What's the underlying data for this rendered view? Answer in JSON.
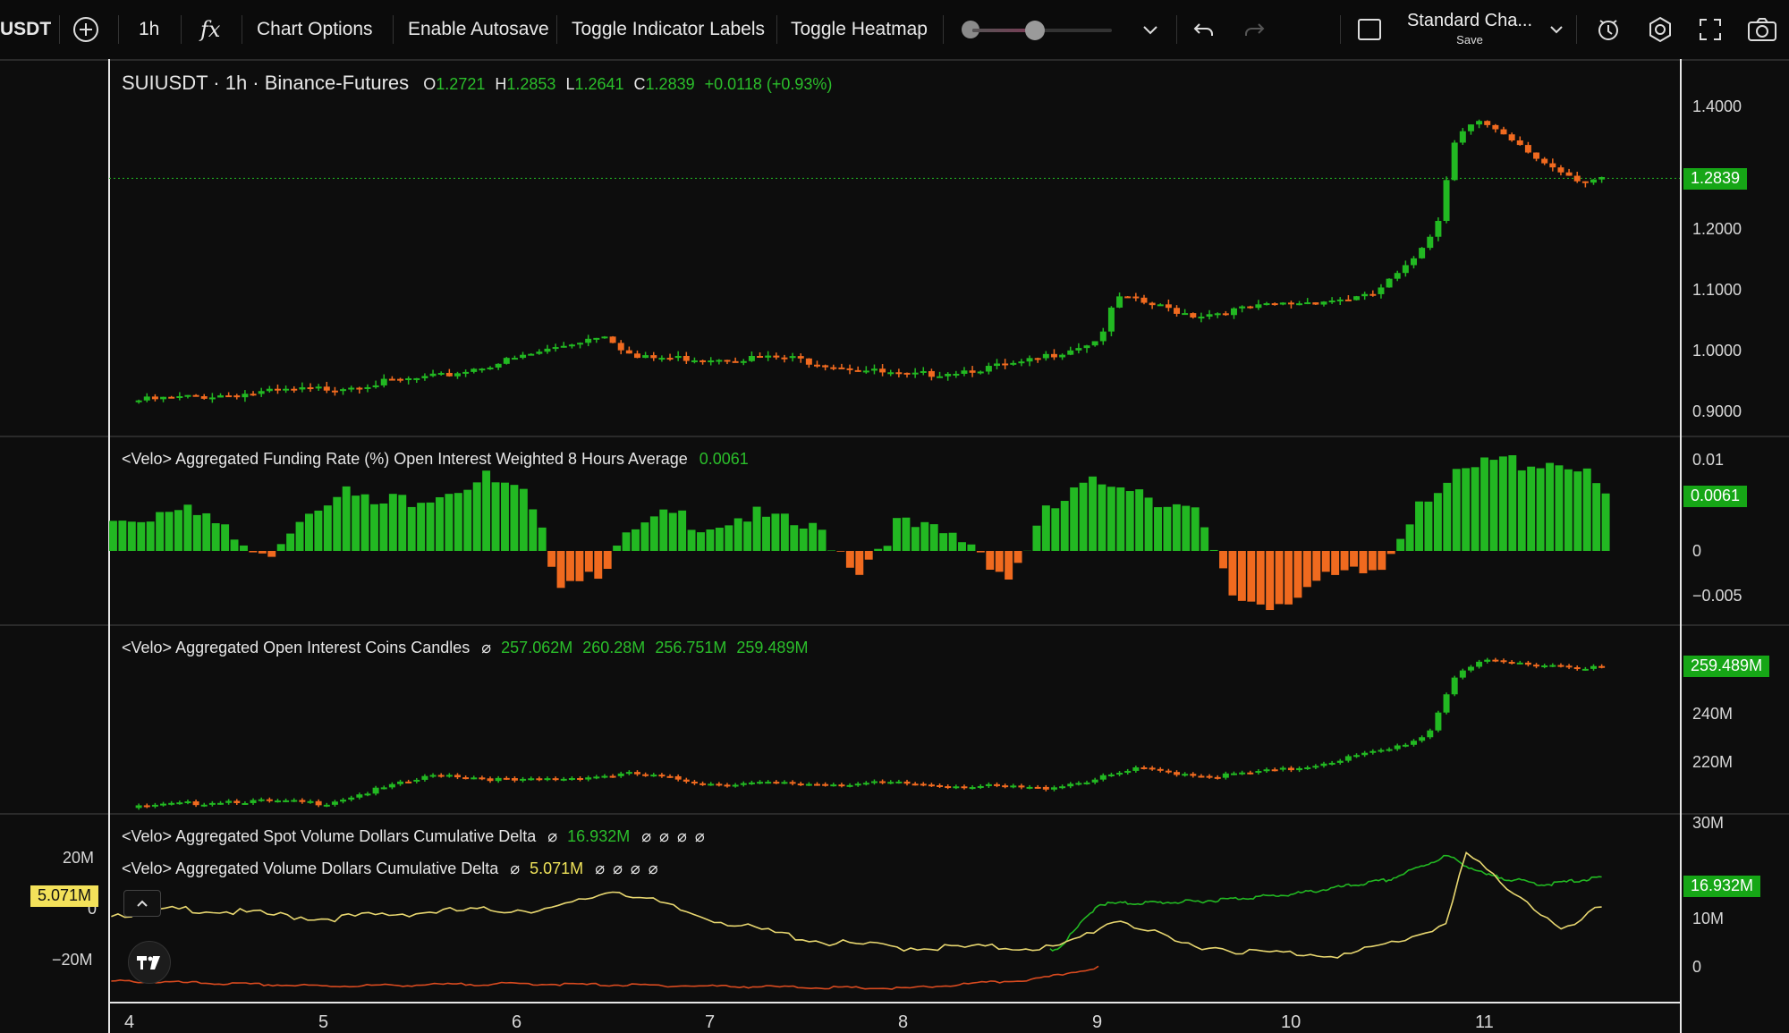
{
  "toolbar": {
    "symbol": "USDT",
    "interval": "1h",
    "fx_label": "fx",
    "chart_options": "Chart Options",
    "enable_autosave": "Enable Autosave",
    "toggle_indicator_labels": "Toggle Indicator Labels",
    "toggle_heatmap": "Toggle Heatmap",
    "layout_name": "Standard Cha...",
    "layout_sub": "Save",
    "slider_level": 0.45,
    "icons": [
      "add-symbol-icon",
      "indicators-icon",
      "chevron-down-icon",
      "undo-icon",
      "redo-icon",
      "layout-checkbox-icon",
      "alert-icon",
      "settings-icon",
      "fullscreen-icon",
      "camera-icon"
    ]
  },
  "main": {
    "symbol": "SUIUSDT · 1h · Binance-Futures",
    "o_label": "O",
    "o_value": "1.2721",
    "h_label": "H",
    "h_value": "1.2853",
    "l_label": "L",
    "l_value": "1.2641",
    "c_label": "C",
    "c_value": "1.2839",
    "change": "+0.0118 (+0.93%)",
    "last_price": "1.2839",
    "axis": [
      "1.4000",
      "1.2000",
      "1.1000",
      "1.0000",
      "0.9000"
    ]
  },
  "funding": {
    "title": "<Velo> Aggregated Funding Rate (%) Open Interest Weighted 8 Hours Average",
    "value": "0.0061",
    "last": "0.0061",
    "axis": [
      "0.01",
      "0",
      "−0.005"
    ]
  },
  "oi": {
    "title": "<Velo> Aggregated Open Interest Coins Candles",
    "values": [
      "257.062M",
      "260.28M",
      "256.751M",
      "259.489M"
    ],
    "last": "259.489M",
    "axis": [
      "240M",
      "220M"
    ]
  },
  "cvd": {
    "spot_title": "<Velo> Aggregated Spot Volume Dollars Cumulative Delta",
    "spot_value": "16.932M",
    "perp_title": "<Velo> Aggregated Volume Dollars Cumulative Delta",
    "perp_value": "5.071M",
    "spot_last": "16.932M",
    "perp_last": "5.071M",
    "right_axis": [
      "30M",
      "10M",
      "0"
    ],
    "left_axis": [
      "20M",
      "0",
      "−20M"
    ],
    "empty_glyph": "⌀"
  },
  "x_axis": [
    "4",
    "5",
    "6",
    "7",
    "8",
    "9",
    "10",
    "11"
  ],
  "colors": {
    "up": "#22b822",
    "down": "#f06a1f",
    "spot_line": "#22b822",
    "perp_line": "#e8d770",
    "third_line": "#d84a1f",
    "price_tag": "#16a616",
    "highlight_tag": "#f3e15a"
  },
  "chart_data": {
    "type": "candlestick",
    "interval": "1h",
    "x": [
      "4",
      "5",
      "6",
      "7",
      "8",
      "9",
      "10",
      "11"
    ],
    "price_ylim": [
      0.88,
      1.43
    ],
    "price_close_keypoints": [
      [
        4,
        0.92
      ],
      [
        5,
        0.94
      ],
      [
        5.6,
        0.96
      ],
      [
        6,
        0.99
      ],
      [
        6.45,
        1.03
      ],
      [
        6.6,
        0.99
      ],
      [
        7,
        0.99
      ],
      [
        7.4,
        0.99
      ],
      [
        8,
        0.96
      ],
      [
        8.6,
        0.98
      ],
      [
        9,
        1.02
      ],
      [
        9.1,
        1.09
      ],
      [
        9.5,
        1.06
      ],
      [
        10,
        1.08
      ],
      [
        10.4,
        1.09
      ],
      [
        10.6,
        1.14
      ],
      [
        10.75,
        1.21
      ],
      [
        10.85,
        1.36
      ],
      [
        10.95,
        1.38
      ],
      [
        11.3,
        1.31
      ],
      [
        11.5,
        1.28
      ],
      [
        11.6,
        1.2839
      ]
    ],
    "funding_rate_series": [
      0.003,
      0.004,
      0.006,
      0.002,
      -0.001,
      0.004,
      0.007,
      0.005,
      0.006,
      0.007,
      0.008,
      0.006,
      -0.003,
      -0.002,
      0.002,
      0.004,
      0.003,
      0.004,
      0.003,
      0.002,
      -0.002,
      0.003,
      0.002,
      0.001,
      -0.003,
      0.004,
      0.007,
      0.008,
      0.006,
      0.004,
      -0.005,
      -0.006,
      -0.004,
      -0.003,
      -0.002,
      0.006,
      0.008,
      0.01,
      0.01,
      0.01,
      0.0061
    ],
    "oi_close_keypoints": [
      [
        4,
        202
      ],
      [
        4.5,
        205
      ],
      [
        5,
        204
      ],
      [
        5.6,
        216
      ],
      [
        6,
        213
      ],
      [
        6.6,
        216
      ],
      [
        7,
        212
      ],
      [
        8,
        212
      ],
      [
        8.7,
        210
      ],
      [
        9,
        214
      ],
      [
        9.2,
        218
      ],
      [
        9.6,
        215
      ],
      [
        10,
        218
      ],
      [
        10.5,
        226
      ],
      [
        10.7,
        232
      ],
      [
        10.85,
        258
      ],
      [
        11,
        262
      ],
      [
        11.3,
        261
      ],
      [
        11.6,
        259.489
      ]
    ],
    "spot_cvd_keypoints": [
      [
        4,
        -25
      ],
      [
        5,
        -26
      ],
      [
        6,
        -24
      ],
      [
        7,
        -27
      ],
      [
        8,
        -27
      ],
      [
        8.8,
        -12
      ],
      [
        9,
        6
      ],
      [
        9.5,
        7
      ],
      [
        10,
        10
      ],
      [
        10.5,
        16
      ],
      [
        10.8,
        26
      ],
      [
        11,
        18
      ],
      [
        11.3,
        14
      ],
      [
        11.6,
        16.932
      ]
    ],
    "perp_cvd_keypoints": [
      [
        4,
        2
      ],
      [
        4.3,
        4
      ],
      [
        5,
        0
      ],
      [
        5.6,
        3
      ],
      [
        6.2,
        4
      ],
      [
        6.5,
        12
      ],
      [
        6.9,
        2
      ],
      [
        7.2,
        -4
      ],
      [
        7.6,
        -10
      ],
      [
        8,
        -12
      ],
      [
        8.8,
        -12
      ],
      [
        9.1,
        0
      ],
      [
        9.4,
        -10
      ],
      [
        9.8,
        -14
      ],
      [
        10.3,
        -15
      ],
      [
        10.6,
        -8
      ],
      [
        10.8,
        -2
      ],
      [
        10.9,
        27
      ],
      [
        11,
        20
      ],
      [
        11.2,
        8
      ],
      [
        11.4,
        -6
      ],
      [
        11.6,
        5.071
      ]
    ],
    "third_line_keypoints": [
      [
        4,
        -26
      ],
      [
        5,
        -28
      ],
      [
        6,
        -27
      ],
      [
        7,
        -28
      ],
      [
        8,
        -29
      ],
      [
        8.7,
        -25
      ],
      [
        9,
        -20
      ]
    ]
  }
}
